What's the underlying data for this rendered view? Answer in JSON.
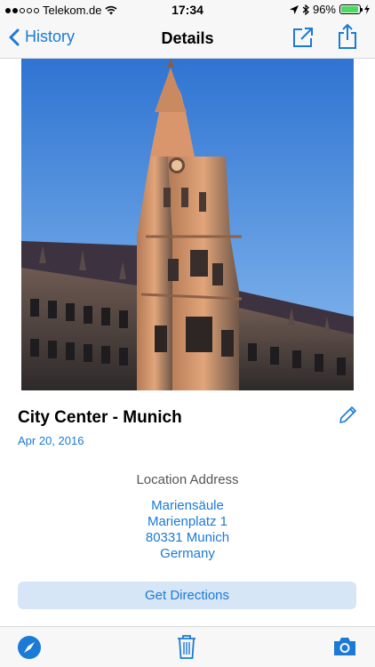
{
  "status": {
    "carrier": "Telekom.de",
    "time": "17:34",
    "battery": "96%",
    "battery_level": 0.96
  },
  "nav": {
    "back_label": "History",
    "title": "Details"
  },
  "detail": {
    "title": "City Center - Munich",
    "date": "Apr 20, 2016",
    "address_label": "Location Address",
    "address_lines": [
      "Mariensäule",
      "Marienplatz 1",
      "80331 Munich",
      "Germany"
    ],
    "directions_label": "Get Directions"
  },
  "colors": {
    "accent": "#1b7ad6",
    "button_bg": "#d6e6f7",
    "battery_green": "#4cd964"
  },
  "icons": {
    "nav": [
      "open-external-icon",
      "share-icon"
    ],
    "toolbar": [
      "compass-icon",
      "trash-icon",
      "camera-icon"
    ]
  }
}
